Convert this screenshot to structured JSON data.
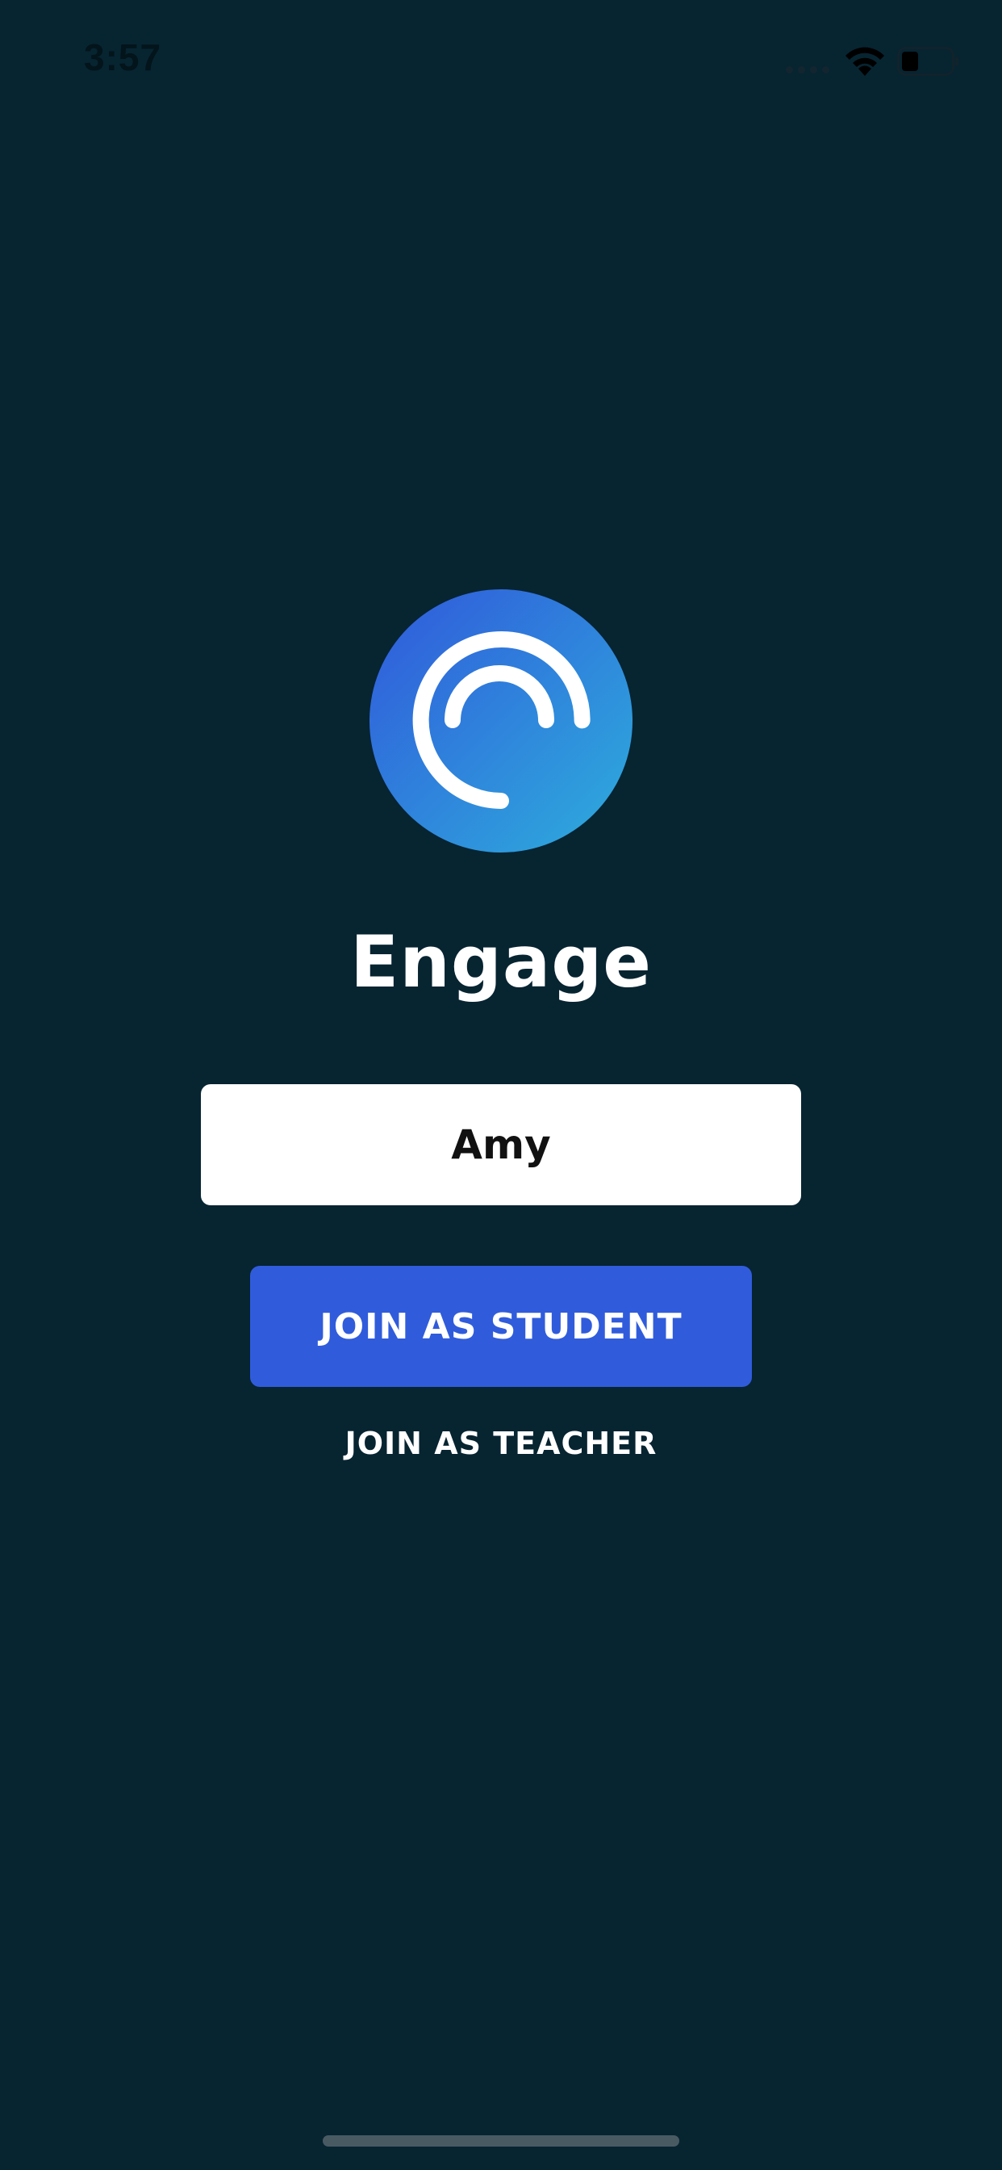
{
  "status_bar": {
    "time": "3:57",
    "icons": [
      "cell-signal-icon",
      "wifi-icon",
      "battery-icon"
    ]
  },
  "app": {
    "title": "Engage",
    "logo_icon": "engage-logo-icon"
  },
  "form": {
    "name_value": "Amy",
    "student_button_label": "JOIN AS STUDENT",
    "teacher_link_label": "JOIN AS TEACHER"
  },
  "colors": {
    "background": "#072431",
    "primary_button": "#305cdb",
    "logo_gradient_start": "#3060dc",
    "logo_gradient_end": "#2ea8dd",
    "text_light": "#ffffff"
  }
}
